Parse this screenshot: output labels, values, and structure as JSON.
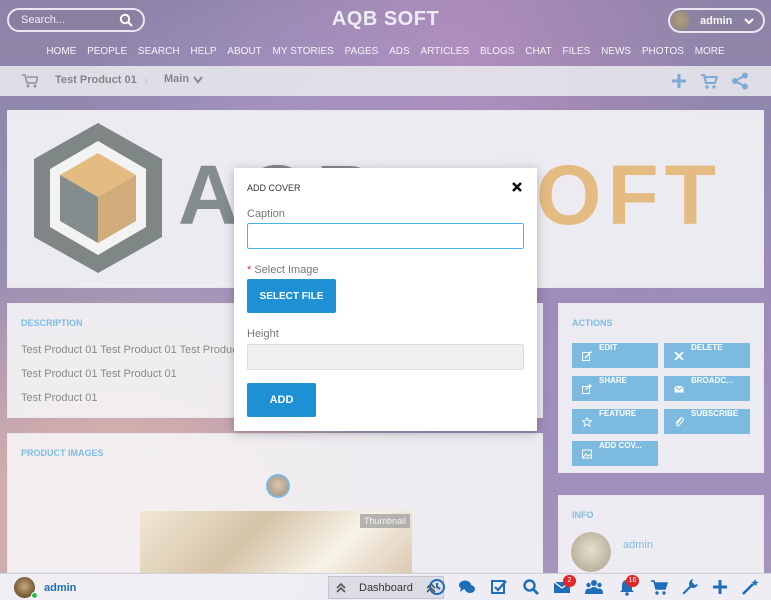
{
  "search": {
    "placeholder": "Search..."
  },
  "brand": "AQB SOFT",
  "user": {
    "name": "admin"
  },
  "nav": [
    "HOME",
    "PEOPLE",
    "SEARCH",
    "HELP",
    "ABOUT",
    "MY STORIES",
    "PAGES",
    "ADS",
    "ARTICLES",
    "BLOGS",
    "CHAT",
    "FILES",
    "NEWS",
    "PHOTOS",
    "MORE"
  ],
  "breadcrumb": {
    "product": "Test Product 01",
    "section": "Main"
  },
  "banner": {
    "logo_left": "AQB",
    "logo_right": "OFT"
  },
  "description": {
    "heading": "DESCRIPTION",
    "lines": [
      "Test Product 01 Test Product 01 Test Product 01",
      "Test Product 01 Test Product 01",
      "Test Product 01"
    ]
  },
  "product_images": {
    "heading": "PRODUCT IMAGES",
    "thumb_label": "Thumbnail"
  },
  "actions": {
    "heading": "ACTIONS",
    "buttons": [
      "EDIT",
      "DELETE",
      "SHARE",
      "BROADC...",
      "FEATURE",
      "SUBSCRIBE",
      "ADD COV..."
    ]
  },
  "info": {
    "heading": "INFO",
    "user": "admin"
  },
  "dock": {
    "user": "admin",
    "dashboard": "Dashboard",
    "mail_badge": "2",
    "notif_badge": "16"
  },
  "modal": {
    "title": "ADD COVER",
    "caption_label": "Caption",
    "caption_value": "",
    "required_mark": "*",
    "image_label": "Select Image",
    "select_file": "SELECT FILE",
    "height_label": "Height",
    "height_value": "",
    "add": "ADD"
  },
  "colors": {
    "accent": "#1e90d4",
    "badge": "#e02828",
    "online": "#2cc04a"
  }
}
